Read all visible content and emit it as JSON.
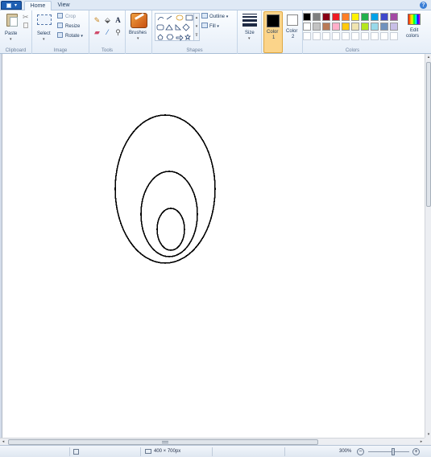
{
  "tabs": {
    "home": "Home",
    "view": "View"
  },
  "groups": {
    "clipboard": "Clipboard",
    "image": "Image",
    "tools": "Tools",
    "shapes": "Shapes",
    "colors": "Colors"
  },
  "clipboard": {
    "paste": "Paste"
  },
  "image": {
    "select": "Select",
    "crop": "Crop",
    "resize": "Resize",
    "rotate": "Rotate"
  },
  "brushes": {
    "label": "Brushes"
  },
  "shapes": {
    "outline": "Outline",
    "fill": "Fill"
  },
  "size": {
    "label": "Size"
  },
  "color1": {
    "line1": "Color",
    "line2": "1",
    "value": "#000000"
  },
  "color2": {
    "line1": "Color",
    "line2": "2",
    "value": "#ffffff"
  },
  "edit_colors": {
    "line1": "Edit",
    "line2": "colors"
  },
  "palette": {
    "row1": [
      "#000000",
      "#7f7f7f",
      "#880015",
      "#ed1c24",
      "#ff7f27",
      "#fff200",
      "#22b14c",
      "#00a2e8",
      "#3f48cc",
      "#a349a4"
    ],
    "row2": [
      "#ffffff",
      "#c3c3c3",
      "#b97a57",
      "#ffaec9",
      "#ffc90e",
      "#efe4b0",
      "#b5e61d",
      "#99d9ea",
      "#7092be",
      "#c8bfe7"
    ],
    "row3": [
      "#ffffff",
      "#ffffff",
      "#ffffff",
      "#ffffff",
      "#ffffff",
      "#ffffff",
      "#ffffff",
      "#ffffff",
      "#ffffff",
      "#ffffff"
    ]
  },
  "status": {
    "image_size": "400 × 700px",
    "zoom": "300%",
    "zoom_slider_fraction": 0.6
  },
  "accent": {
    "ribbon_tab": "#1f5fb3",
    "selected_color_button": "#fbd48a"
  }
}
